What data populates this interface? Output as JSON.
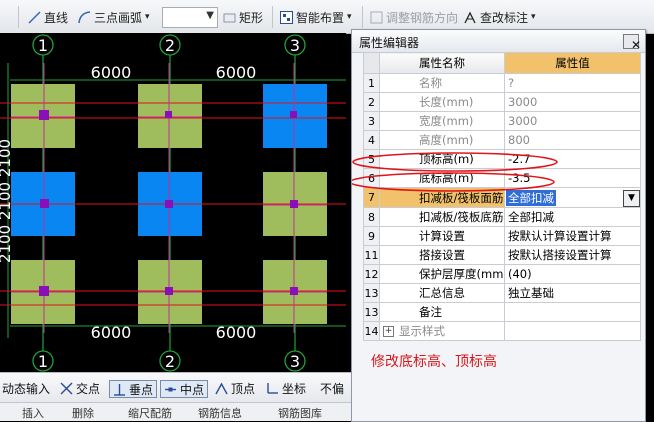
{
  "toolbar": {
    "line": "直线",
    "arc3": "三点画弧",
    "rect": "矩形",
    "smart": "智能布置",
    "adjust": "调整钢筋方向",
    "annot": "查改标注"
  },
  "canvas": {
    "axes": [
      "1",
      "2",
      "3"
    ],
    "dims": [
      "6000",
      "6000",
      "6000",
      "6000"
    ],
    "side_dim": "2100 2100 2100"
  },
  "dialog": {
    "title": "属性编辑器",
    "col_name": "属性名称",
    "col_value": "属性值",
    "rows": [
      {
        "n": "1",
        "name": "名称",
        "value": "?"
      },
      {
        "n": "2",
        "name": "长度(mm)",
        "value": "3000"
      },
      {
        "n": "3",
        "name": "宽度(mm)",
        "value": "3000"
      },
      {
        "n": "4",
        "name": "高度(mm)",
        "value": "800"
      },
      {
        "n": "5",
        "name": "顶标高(m)",
        "value": "-2.7"
      },
      {
        "n": "6",
        "name": "底标高(m)",
        "value": "-3.5"
      },
      {
        "n": "7",
        "name": "扣减板/筏板面筋",
        "value": "全部扣减"
      },
      {
        "n": "8",
        "name": "扣减板/筏板底筋",
        "value": "全部扣减"
      },
      {
        "n": "9",
        "name": "计算设置",
        "value": "按默认计算设置计算"
      },
      {
        "n": "11",
        "name": "搭接设置",
        "value": "按默认搭接设置计算"
      },
      {
        "n": "12",
        "name": "保护层厚度(mm)",
        "value": "(40)"
      },
      {
        "n": "13",
        "name": "汇总信息",
        "value": "独立基础"
      },
      {
        "n": "13",
        "name": "备注",
        "value": ""
      },
      {
        "n": "14",
        "name": "显示样式",
        "value": ""
      }
    ],
    "note": "修改底标高、顶标高"
  },
  "statusbar": {
    "dyn": "动态输入",
    "cross": "交点",
    "perp": "垂点",
    "mid": "中点",
    "vertex": "顶点",
    "coord": "坐标",
    "noshift": "不偏"
  },
  "bottombar": {
    "insert": "插入",
    "delete": "删除",
    "dim": "缩尺配筋",
    "info": "钢筋信息",
    "lib": "钢筋图库"
  }
}
